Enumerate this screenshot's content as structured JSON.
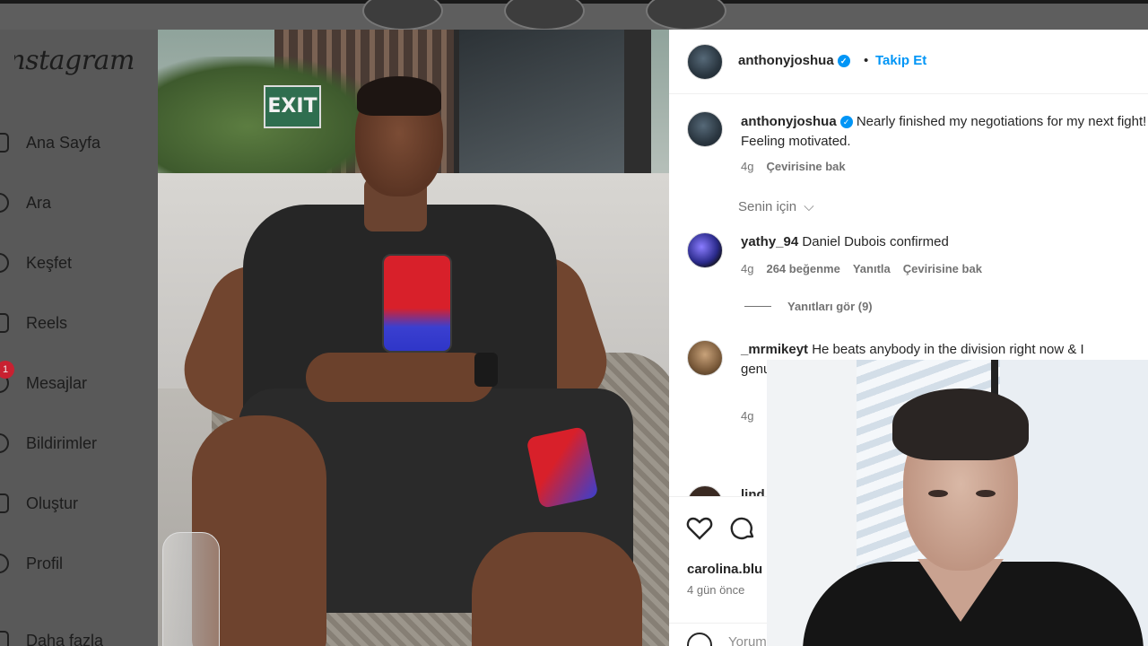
{
  "app": {
    "logo_text": "Instagram",
    "nav_items": [
      {
        "label": "Ana Sayfa",
        "icon": "home-icon"
      },
      {
        "label": "Ara",
        "icon": "search-icon"
      },
      {
        "label": "Keşfet",
        "icon": "explore-icon"
      },
      {
        "label": "Reels",
        "icon": "reels-icon"
      },
      {
        "label": "Mesajlar",
        "icon": "messenger-icon",
        "badge": "1"
      },
      {
        "label": "Bildirimler",
        "icon": "heart-icon"
      },
      {
        "label": "Oluştur",
        "icon": "create-icon"
      },
      {
        "label": "Profil",
        "icon": "avatar-icon"
      },
      {
        "label": "Daha fazla",
        "icon": "menu-icon"
      }
    ]
  },
  "post": {
    "exit_sign": "EXIT",
    "header": {
      "username": "anthonyjoshua",
      "separator": "•",
      "follow_label": "Takip Et"
    },
    "caption": {
      "username": "anthonyjoshua",
      "text": "Nearly finished my negotiations for my next fight! Feeling motivated.",
      "time": "4g",
      "translate": "Çevirisine bak"
    },
    "sort_label": "Senin için",
    "comments": [
      {
        "username": "yathy_94",
        "text": "Daniel Dubois confirmed",
        "time": "4g",
        "likes": "264 beğenme",
        "reply": "Yanıtla",
        "translate": "Çevirisine bak",
        "view_replies": "Yanıtları gör (9)"
      },
      {
        "username": "_mrmikeyt",
        "text": "He beats anybody in the division right now & I genuinely believe he will beat",
        "time": "4g"
      },
      {
        "username": "lind"
      }
    ],
    "likers": "carolina.blu",
    "posted_ago": "4 gün önce",
    "comment_placeholder": "Yorum ekle..."
  },
  "colors": {
    "accent": "#0095f6",
    "badge": "#ed4956",
    "text": "#262626",
    "muted": "#737373"
  }
}
